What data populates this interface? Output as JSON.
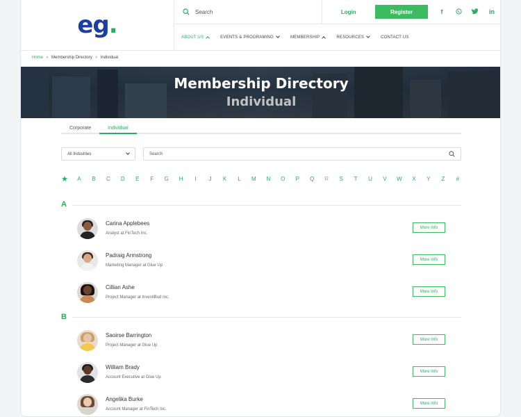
{
  "header": {
    "logo_text": "eg",
    "logo_dot": ".",
    "search_label": "Search",
    "login_label": "Login",
    "register_label": "Register",
    "socials": [
      "f",
      "◎",
      "🐦",
      "in"
    ],
    "nav": [
      {
        "label": "ABOUT US",
        "active": true
      },
      {
        "label": "EVENTS & PROGRAMING"
      },
      {
        "label": "MEMBERSHIP"
      },
      {
        "label": "RESOURCES"
      },
      {
        "label": "CONTACT US"
      }
    ]
  },
  "breadcrumb": [
    "Home",
    "Membership Directory",
    "Individual"
  ],
  "hero": {
    "title": "Membership Directory",
    "subtitle": "Individual"
  },
  "tabs": [
    "Corporate",
    "Individual"
  ],
  "filters": {
    "industry": "All Industries",
    "search_placeholder": "Search"
  },
  "alphabet": [
    "A",
    "B",
    "C",
    "D",
    "E",
    "F",
    "G",
    "H",
    "I",
    "J",
    "K",
    "L",
    "M",
    "N",
    "O",
    "P",
    "Q",
    "R",
    "S",
    "T",
    "U",
    "V",
    "W",
    "X",
    "Y",
    "Z",
    "#"
  ],
  "sections": [
    {
      "letter": "A",
      "members": [
        {
          "name": "Carina Applebees",
          "role": "Analyst at FinTech Inc."
        },
        {
          "name": "Padraig Armstrong",
          "role": "Marketing Manager at Glue Up"
        },
        {
          "name": "Cillian Ashe",
          "role": "Project Manager at InvestiBud Inc."
        }
      ]
    },
    {
      "letter": "B",
      "members": [
        {
          "name": "Saoirse Barrington",
          "role": "Project Manager at Glue Up"
        },
        {
          "name": "William Brady",
          "role": "Account Executive at Glue Up"
        },
        {
          "name": "Angelika Burke",
          "role": "Account Manager at FinTech Inc."
        }
      ]
    }
  ],
  "more_info_label": "More Info",
  "colors": {
    "brand_green": "#27ae60",
    "logo_blue": "#1f3fa0"
  }
}
